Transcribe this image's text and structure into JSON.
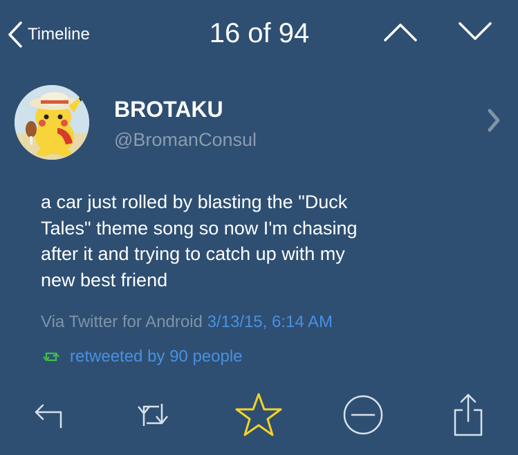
{
  "nav": {
    "back_label": "Timeline",
    "counter": "16 of 94"
  },
  "profile": {
    "display_name": "BROTAKU",
    "handle": "@BromanConsul"
  },
  "tweet": {
    "text": "a car just rolled by blasting the \"Duck\nTales\" theme song so now I'm chasing\nafter it and trying to catch up with my\nnew best friend",
    "via": "Via Twitter for Android",
    "date": "3/13/15, 6:14 AM",
    "retweeted_by": "retweeted by 90 people"
  },
  "toolbar": {
    "icons": [
      "reply-icon",
      "retweet-icon",
      "favorite-star-icon",
      "mute-icon",
      "share-icon"
    ]
  },
  "colors": {
    "background": "#2e4f72",
    "link_blue": "#4a90e2",
    "muted_gray": "#7f93a8",
    "retweet_green": "#3fbf4a",
    "favorite_yellow": "#f5d327"
  }
}
